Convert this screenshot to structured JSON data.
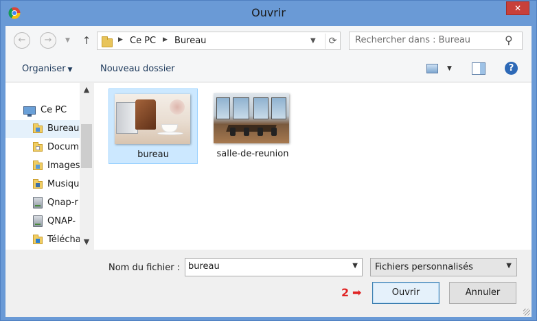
{
  "window": {
    "title": "Ouvrir",
    "close_label": "✕",
    "app_icon": "chrome-icon"
  },
  "nav": {
    "back_icon": "back-arrow-icon",
    "forward_icon": "forward-arrow-icon",
    "up_icon": "up-arrow-icon"
  },
  "address": {
    "crumbs": [
      "Ce PC",
      "Bureau"
    ],
    "refresh_icon": "refresh-icon"
  },
  "search": {
    "placeholder": "Rechercher dans : Bureau",
    "icon": "search-icon"
  },
  "toolbar": {
    "organize_label": "Organiser",
    "new_folder_label": "Nouveau dossier",
    "help_label": "?"
  },
  "navpane": {
    "items": [
      {
        "label": "Ce PC",
        "icon": "computer-icon"
      },
      {
        "label": "Bureau",
        "icon": "desktop-folder-icon",
        "selected": true
      },
      {
        "label": "Docum",
        "icon": "documents-folder-icon"
      },
      {
        "label": "Images",
        "icon": "pictures-folder-icon"
      },
      {
        "label": "Musiqu",
        "icon": "music-folder-icon"
      },
      {
        "label": "Qnap-r",
        "icon": "network-drive-icon"
      },
      {
        "label": "QNAP-",
        "icon": "network-drive-icon"
      },
      {
        "label": "Télécha",
        "icon": "downloads-folder-icon"
      }
    ]
  },
  "files": [
    {
      "name": "bureau",
      "selected": true
    },
    {
      "name": "salle-de-reunion",
      "selected": false
    }
  ],
  "bottom": {
    "filename_label": "Nom du fichier :",
    "filename_value": "bureau",
    "filetype_value": "Fichiers personnalisés",
    "step_number": "2",
    "step_arrow": "➡",
    "open_label": "Ouvrir",
    "cancel_label": "Annuler"
  },
  "colors": {
    "titlebar": "#6a9ad6",
    "close": "#c8403a",
    "selection": "#cce8ff",
    "annotation": "#e02424"
  }
}
